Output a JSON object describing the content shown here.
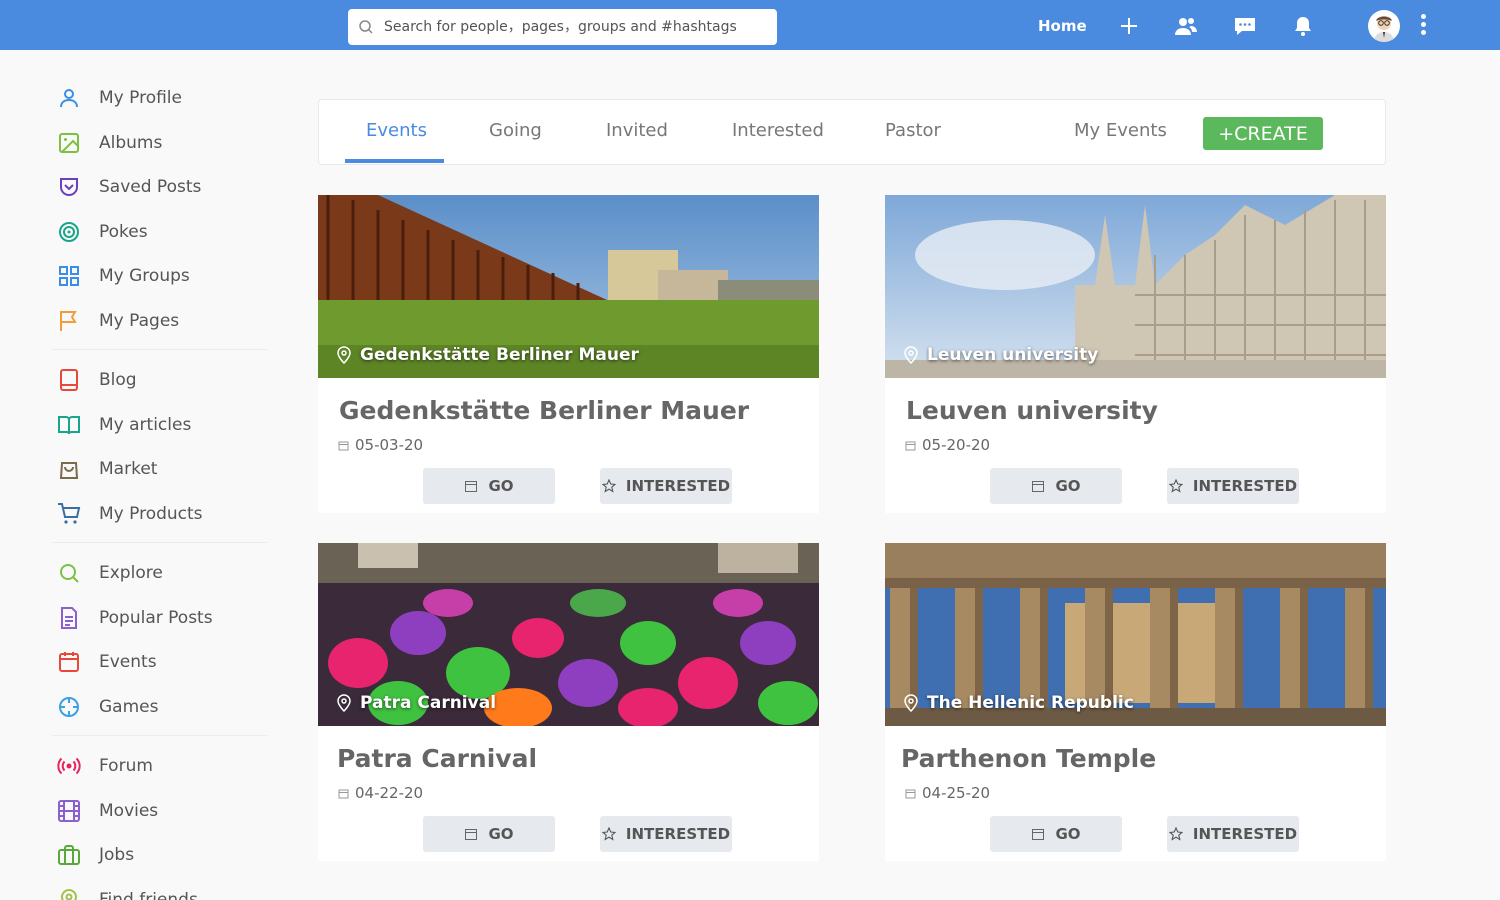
{
  "search": {
    "placeholder": "Search for people，pages，groups and #hashtags"
  },
  "topbar": {
    "home_label": "Home"
  },
  "sidebar": {
    "groups": [
      [
        {
          "label": "My Profile",
          "icon": "user-icon"
        },
        {
          "label": "Albums",
          "icon": "image-icon"
        },
        {
          "label": "Saved Posts",
          "icon": "bookmark-icon"
        },
        {
          "label": "Pokes",
          "icon": "target-icon"
        },
        {
          "label": "My Groups",
          "icon": "grid-icon"
        },
        {
          "label": "My Pages",
          "icon": "flag-icon"
        }
      ],
      [
        {
          "label": "Blog",
          "icon": "book-icon"
        },
        {
          "label": "My articles",
          "icon": "open-book-icon"
        },
        {
          "label": "Market",
          "icon": "shopping-bag-icon"
        },
        {
          "label": "My Products",
          "icon": "cart-icon"
        }
      ],
      [
        {
          "label": "Explore",
          "icon": "search-icon"
        },
        {
          "label": "Popular Posts",
          "icon": "document-icon"
        },
        {
          "label": "Events",
          "icon": "calendar-icon"
        },
        {
          "label": "Games",
          "icon": "crosshair-icon"
        }
      ],
      [
        {
          "label": "Forum",
          "icon": "broadcast-icon"
        },
        {
          "label": "Movies",
          "icon": "film-icon"
        },
        {
          "label": "Jobs",
          "icon": "briefcase-icon"
        },
        {
          "label": "Find friends",
          "icon": "map-pin-icon"
        }
      ]
    ]
  },
  "tabs": {
    "items": [
      "Events",
      "Going",
      "Invited",
      "Interested",
      "Pastor",
      "My Events"
    ],
    "active": "Events",
    "create_label": "+CREATE"
  },
  "events": [
    {
      "location": "Gedenkstätte Berliner Mauer",
      "title": "Gedenkstätte Berliner Mauer",
      "date": "05-03-20",
      "go_label": "GO",
      "interested_label": "INTERESTED"
    },
    {
      "location": "Leuven university",
      "title": "Leuven university",
      "date": "05-20-20",
      "go_label": "GO",
      "interested_label": "INTERESTED"
    },
    {
      "location": "Patra Carnival",
      "title": "Patra Carnival",
      "date": "04-22-20",
      "go_label": "GO",
      "interested_label": "INTERESTED"
    },
    {
      "location": "The Hellenic Republic",
      "title": "Parthenon Temple",
      "date": "04-25-20",
      "go_label": "GO",
      "interested_label": "INTERESTED"
    }
  ],
  "colors": {
    "topbar": "#4a8be0",
    "accent": "#4a8be0",
    "create": "#5cb85c",
    "button_bg": "#e6eaee"
  }
}
